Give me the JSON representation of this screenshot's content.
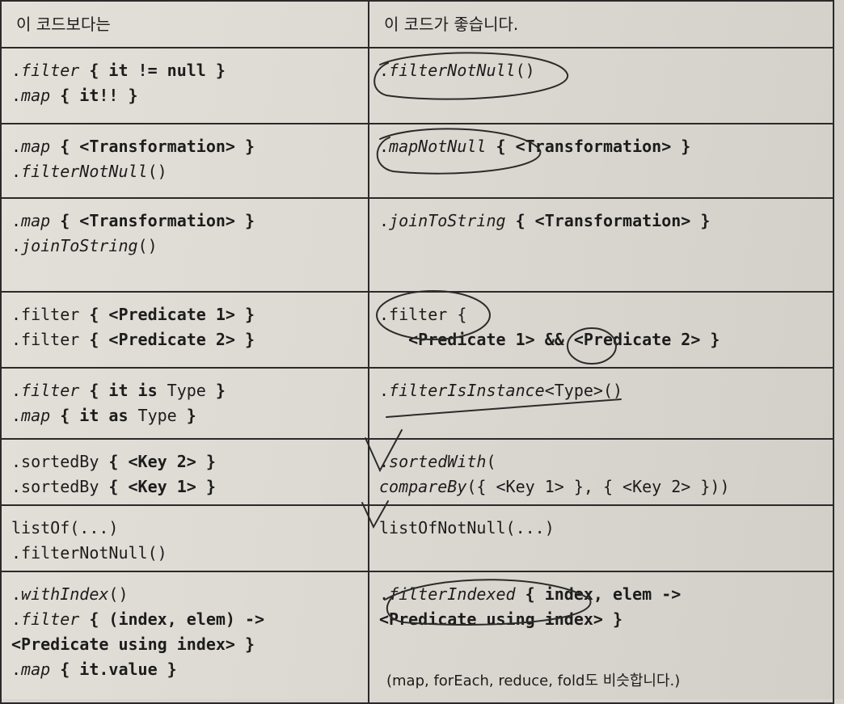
{
  "header": {
    "left": "이 코드보다는",
    "right": "이 코드가 좋습니다."
  },
  "rows": [
    {
      "left": [
        [
          {
            "t": ".",
            "s": ""
          },
          {
            "t": "filter",
            "s": "i"
          },
          {
            "t": " { it != null }",
            "s": "b"
          }
        ],
        [
          {
            "t": ".",
            "s": ""
          },
          {
            "t": "map",
            "s": "i"
          },
          {
            "t": " { it!! }",
            "s": "b"
          }
        ]
      ],
      "right": [
        [
          {
            "t": ".",
            "s": ""
          },
          {
            "t": "filterNotNull",
            "s": "i"
          },
          {
            "t": "()",
            "s": ""
          }
        ]
      ]
    },
    {
      "left": [
        [
          {
            "t": ".",
            "s": ""
          },
          {
            "t": "map",
            "s": "i"
          },
          {
            "t": " { <Transformation> }",
            "s": "b"
          }
        ],
        [
          {
            "t": ".",
            "s": ""
          },
          {
            "t": "filterNotNull",
            "s": "i"
          },
          {
            "t": "()",
            "s": ""
          }
        ]
      ],
      "right": [
        [
          {
            "t": ".",
            "s": ""
          },
          {
            "t": "mapNotNull",
            "s": "i"
          },
          {
            "t": " { <Transformation> }",
            "s": "b"
          }
        ]
      ]
    },
    {
      "left": [
        [
          {
            "t": ".",
            "s": ""
          },
          {
            "t": "map",
            "s": "i"
          },
          {
            "t": " { <Transformation> }",
            "s": "b"
          }
        ],
        [
          {
            "t": ".",
            "s": ""
          },
          {
            "t": "joinToString",
            "s": "i"
          },
          {
            "t": "()",
            "s": ""
          }
        ]
      ],
      "right": [
        [
          {
            "t": ".",
            "s": ""
          },
          {
            "t": "joinToString",
            "s": "i"
          },
          {
            "t": " { <Transformation> }",
            "s": "b"
          }
        ]
      ]
    },
    {
      "left": [
        [
          {
            "t": ".filter",
            "s": ""
          },
          {
            "t": " { <Predicate 1> }",
            "s": "b"
          }
        ],
        [
          {
            "t": ".filter",
            "s": ""
          },
          {
            "t": " { <Predicate 2> }",
            "s": "b"
          }
        ]
      ],
      "right": [
        [
          {
            "t": ".filter {",
            "s": ""
          }
        ],
        [
          {
            "t": "   <Predicate 1> && <Predicate 2> }",
            "s": "b"
          }
        ]
      ]
    },
    {
      "left": [
        [
          {
            "t": ".",
            "s": ""
          },
          {
            "t": "filter",
            "s": "i"
          },
          {
            "t": " { it is ",
            "s": "b"
          },
          {
            "t": "Type",
            "s": ""
          },
          {
            "t": " }",
            "s": "b"
          }
        ],
        [
          {
            "t": ".",
            "s": ""
          },
          {
            "t": "map",
            "s": "i"
          },
          {
            "t": " { it as ",
            "s": "b"
          },
          {
            "t": "Type",
            "s": ""
          },
          {
            "t": " }",
            "s": "b"
          }
        ]
      ],
      "right": [
        [
          {
            "t": ".",
            "s": ""
          },
          {
            "t": "filterIsInstance",
            "s": "i"
          },
          {
            "t": "<Type>()",
            "s": ""
          }
        ]
      ]
    },
    {
      "left": [
        [
          {
            "t": ".sortedBy",
            "s": ""
          },
          {
            "t": " { <Key 2> }",
            "s": "b"
          }
        ],
        [
          {
            "t": ".sortedBy",
            "s": ""
          },
          {
            "t": " { <Key 1> }",
            "s": "b"
          }
        ]
      ],
      "right": [
        [
          {
            "t": ".",
            "s": ""
          },
          {
            "t": "sortedWith",
            "s": "i"
          },
          {
            "t": "(",
            "s": ""
          }
        ],
        [
          {
            "t": "compareBy",
            "s": "i"
          },
          {
            "t": "({ <Key 1> }, { <Key 2> }))",
            "s": ""
          }
        ]
      ]
    },
    {
      "left": [
        [
          {
            "t": "listOf(...)",
            "s": ""
          }
        ],
        [
          {
            "t": ".filterNotNull()",
            "s": ""
          }
        ]
      ],
      "right": [
        [
          {
            "t": "listOfNotNull(...)",
            "s": ""
          }
        ]
      ]
    },
    {
      "left": [
        [
          {
            "t": ".",
            "s": ""
          },
          {
            "t": "withIndex",
            "s": "i"
          },
          {
            "t": "()",
            "s": ""
          }
        ],
        [
          {
            "t": ".",
            "s": ""
          },
          {
            "t": "filter",
            "s": "i"
          },
          {
            "t": " { (index, elem) ->",
            "s": "b"
          }
        ],
        [
          {
            "t": "<Predicate using index> }",
            "s": "b"
          }
        ],
        [
          {
            "t": ".",
            "s": ""
          },
          {
            "t": "map",
            "s": "i"
          },
          {
            "t": " { it.value }",
            "s": "b"
          }
        ]
      ],
      "right": [
        [
          {
            "t": ".",
            "s": ""
          },
          {
            "t": "filterIndexed",
            "s": "i"
          },
          {
            "t": " { index, elem ->",
            "s": "b"
          }
        ],
        [
          {
            "t": "<Predicate using index> }",
            "s": "b"
          }
        ]
      ]
    }
  ],
  "note": "(map, forEach, reduce, fold도 비슷합니다.)"
}
